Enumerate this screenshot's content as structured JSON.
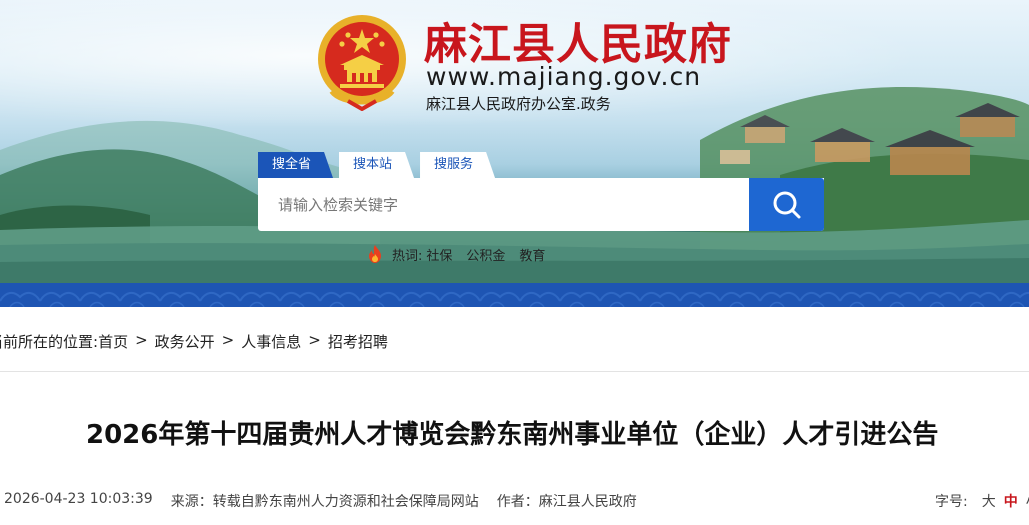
{
  "header": {
    "site_title": "麻江县人民政府",
    "site_url": "www.majiang.gov.cn",
    "site_sub": "麻江县人民政府办公室.政务"
  },
  "search": {
    "tabs": [
      "搜全省",
      "搜本站",
      "搜服务"
    ],
    "active_tab": 0,
    "placeholder": "请输入检索关键字",
    "button_icon": "search-icon"
  },
  "hotwords": {
    "label": "热词:",
    "items": [
      "社保",
      "公积金",
      "教育"
    ],
    "icon": "fire-icon"
  },
  "breadcrumb": {
    "prefix": "当前所在的位置:",
    "items": [
      "首页",
      "政务公开",
      "人事信息",
      "招考招聘"
    ],
    "separator": ">"
  },
  "article": {
    "title": "2026年第十四届贵州人才博览会黔东南州事业单位（企业）人才引进公告",
    "datetime": "2026-04-23 10:03:39",
    "source": "来源：转载自黔东南州人力资源和社会保障局网站",
    "author": "作者：麻江县人民政府"
  },
  "font_size": {
    "label": "字号:",
    "options": [
      "大",
      "中",
      "小"
    ],
    "selected": 1
  },
  "colors": {
    "brand_red": "#c8161d",
    "brand_blue": "#1e55b3",
    "search_button": "#1e67d2"
  }
}
